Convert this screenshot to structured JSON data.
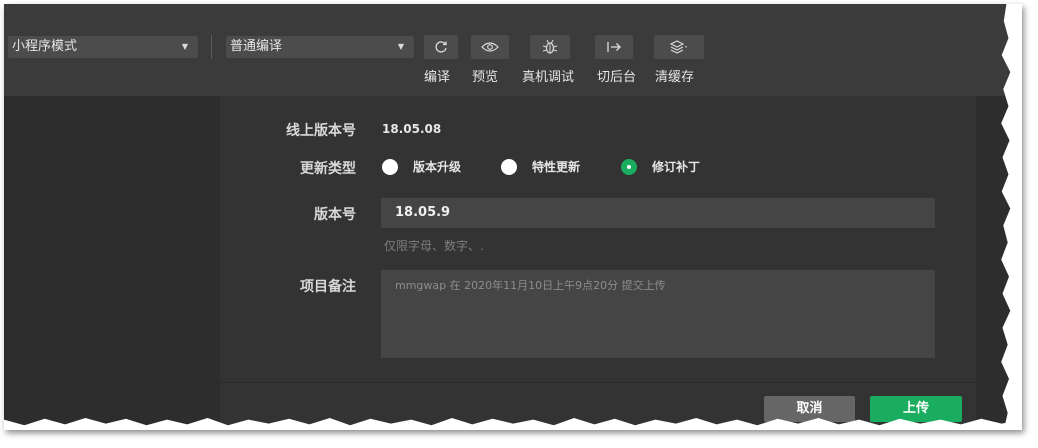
{
  "toolbar": {
    "mode_select": "小程序模式",
    "compile_select": "普通编译",
    "buttons": {
      "compile": "编译",
      "preview": "预览",
      "remote_debug": "真机调试",
      "background": "切后台",
      "clear_cache": "清缓存"
    }
  },
  "dialog": {
    "online_version_label": "线上版本号",
    "online_version_value": "18.05.08",
    "update_type_label": "更新类型",
    "update_types": [
      "版本升级",
      "特性更新",
      "修订补丁"
    ],
    "selected_update_type": "修订补丁",
    "version_label": "版本号",
    "version_value": "18.05.9",
    "version_hint": "仅限字母、数字、.",
    "note_label": "项目备注",
    "note_placeholder": "mmgwap 在 2020年11月10日上午9点20分 提交上传",
    "cancel_label": "取消",
    "upload_label": "上传"
  },
  "colors": {
    "accent": "#1aad5f",
    "toolbar_bg": "#3b3b3b",
    "dialog_bg": "#333333"
  }
}
